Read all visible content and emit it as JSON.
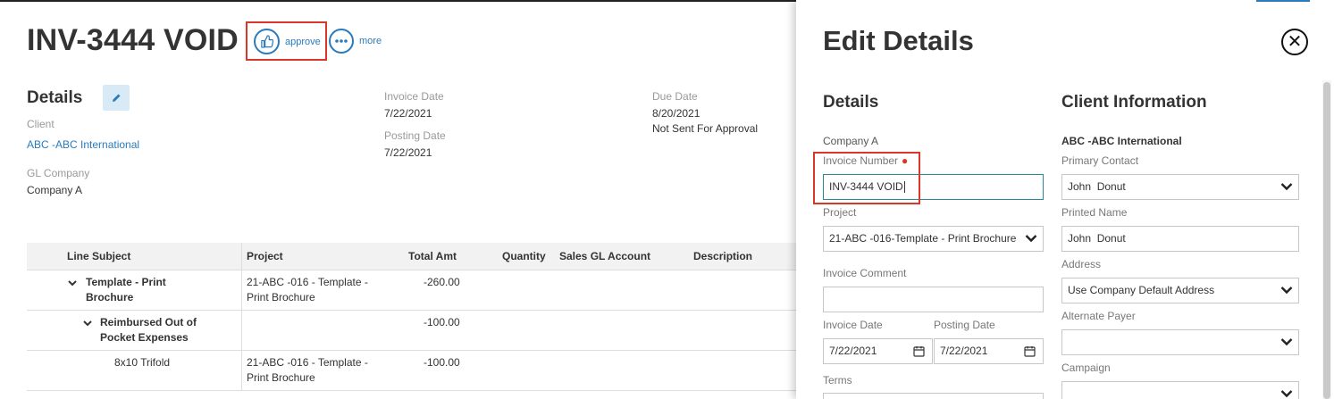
{
  "invoice": {
    "title": "INV-3444 VOID",
    "actions": {
      "approve": "approve",
      "more": "more"
    }
  },
  "details": {
    "heading": "Details",
    "client_label": "Client",
    "client_value": "ABC -ABC International",
    "gl_company_label": "GL Company",
    "gl_company_value": "Company A",
    "invoice_date_label": "Invoice Date",
    "invoice_date_value": "7/22/2021",
    "posting_date_label": "Posting Date",
    "posting_date_value": "7/22/2021",
    "due_date_label": "Due Date",
    "due_date_value": "8/20/2021",
    "approval_status": "Not Sent For Approval"
  },
  "table": {
    "columns": [
      "Line Subject",
      "Project",
      "Total Amt",
      "Quantity",
      "Sales GL Account",
      "Description"
    ],
    "rows": [
      {
        "subject": "Template - Print Brochure",
        "project": "21-ABC -016 - Template - Print Brochure",
        "total": "-260.00"
      },
      {
        "subject": "Reimbursed Out of Pocket Expenses",
        "project": "",
        "total": "-100.00"
      },
      {
        "subject": "8x10 Trifold",
        "project": "21-ABC -016 - Template - Print Brochure",
        "total": "-100.00"
      }
    ]
  },
  "panel": {
    "title": "Edit Details",
    "details_heading": "Details",
    "company_value": "Company A",
    "invoice_number_label": "Invoice Number",
    "invoice_number_value": "INV-3444 VOID",
    "project_label": "Project",
    "project_value": "21-ABC -016-Template - Print Brochure",
    "invoice_comment_label": "Invoice Comment",
    "invoice_comment_value": "",
    "invoice_date_label": "Invoice Date",
    "invoice_date_value": "7/22/2021",
    "posting_date_label": "Posting Date",
    "posting_date_value": "7/22/2021",
    "terms_label": "Terms",
    "client_heading": "Client Information",
    "client_name": "ABC -ABC International",
    "primary_contact_label": "Primary Contact",
    "primary_contact_value": "John  Donut",
    "printed_name_label": "Printed Name",
    "printed_name_value": "John  Donut",
    "address_label": "Address",
    "address_value": "Use Company Default Address",
    "alternate_payer_label": "Alternate Payer",
    "alternate_payer_value": "",
    "campaign_label": "Campaign",
    "campaign_value": ""
  },
  "colors": {
    "accent": "#2a7bbd",
    "highlight": "#d9372a",
    "active_border": "#2a8a9a"
  },
  "icons": [
    "thumbs-up-icon",
    "ellipsis-icon",
    "pencil-icon",
    "close-icon",
    "chevron-down-icon",
    "calendar-icon"
  ]
}
